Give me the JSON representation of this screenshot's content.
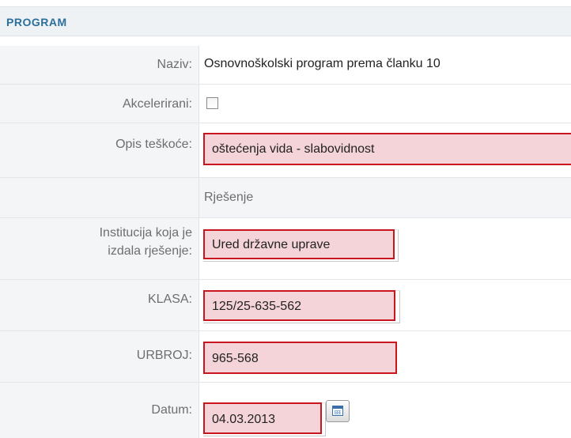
{
  "section": {
    "title": "PROGRAM"
  },
  "fields": {
    "naziv": {
      "label": "Naziv:",
      "value": "Osnovnoškolski program prema članku 10"
    },
    "akcelerirani": {
      "label": "Akcelerirani:",
      "checked": false
    },
    "opis": {
      "label": "Opis teškoće:",
      "value": "oštećenja vida - slabovidnost"
    },
    "rjesenje": {
      "heading": "Rješenje"
    },
    "institucija": {
      "label_line1": "Institucija koja je",
      "label_line2": "izdala rješenje:",
      "value": "Ured državne uprave"
    },
    "klasa": {
      "label": "KLASA:",
      "value": "125/25-635-562"
    },
    "urbroj": {
      "label": "URBROJ:",
      "value": "965-568"
    },
    "datum": {
      "label": "Datum:",
      "value": "04.03.2013"
    }
  },
  "icons": {
    "datepicker": "calendar-icon",
    "checkbox": "checkbox-unchecked"
  },
  "colors": {
    "header_text": "#2c6f9a",
    "invalid_border": "#c9151e",
    "invalid_fill": "#f4d4d8",
    "label_text": "#6e6e6e"
  }
}
